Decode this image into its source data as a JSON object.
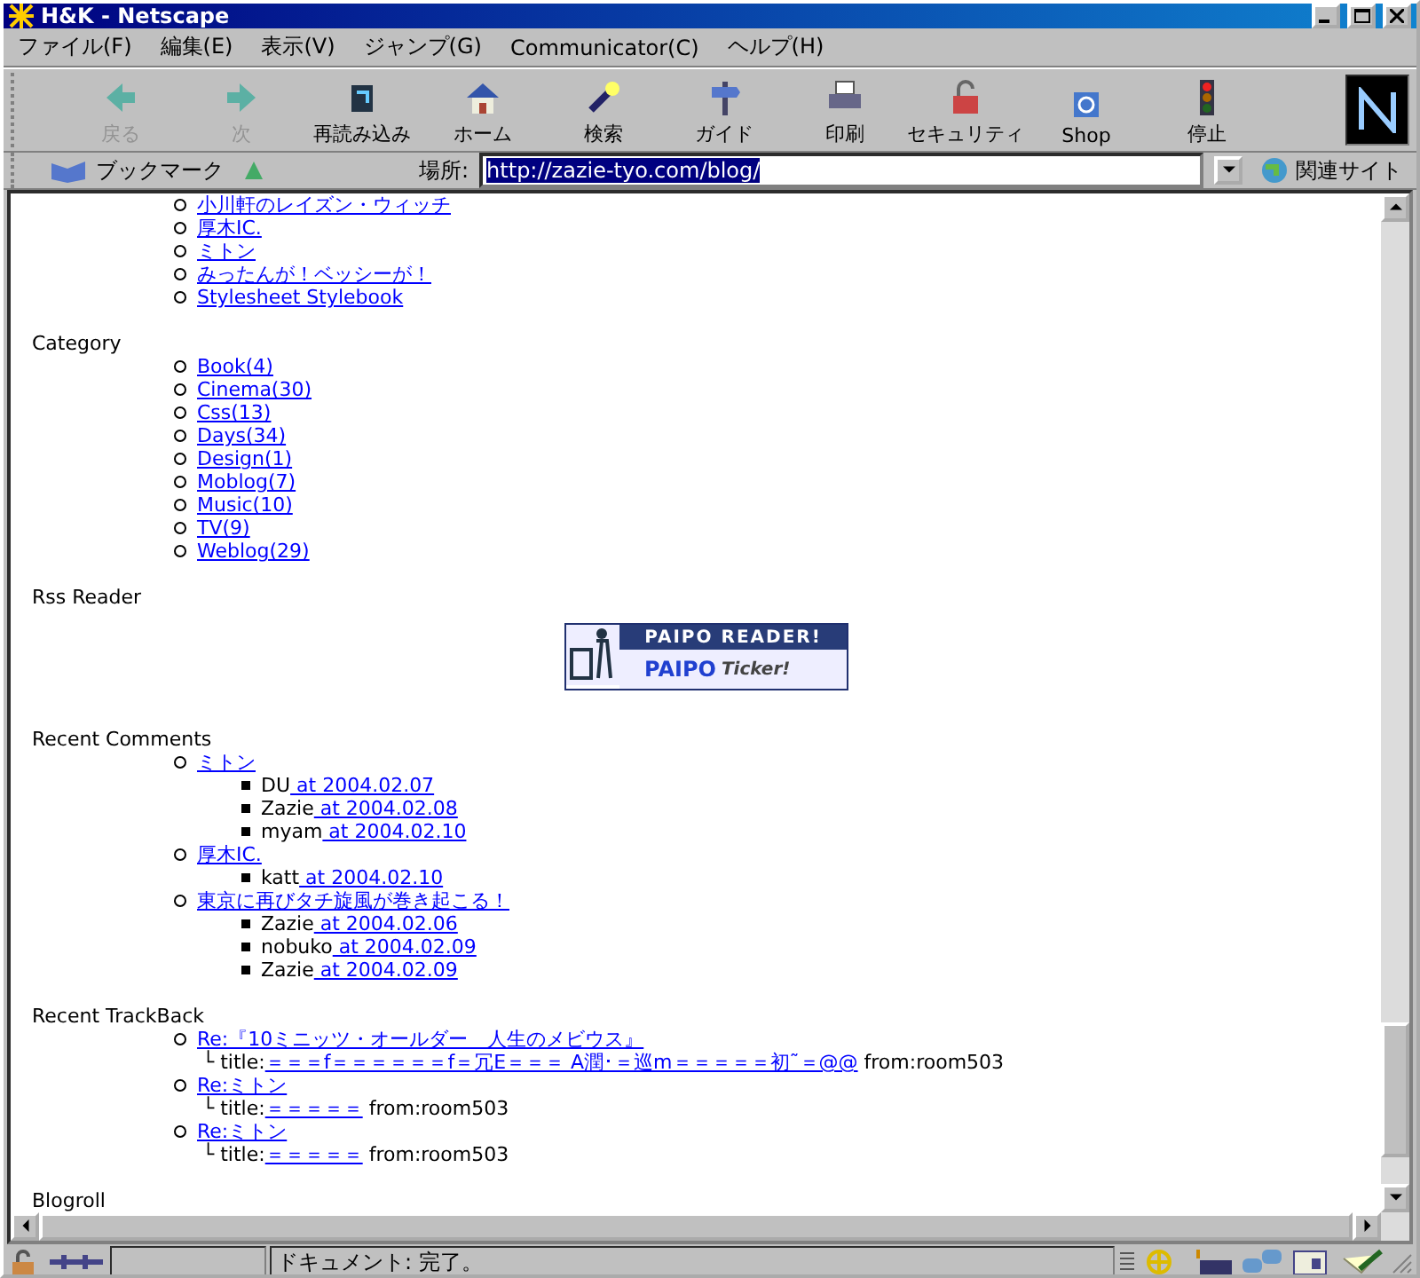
{
  "window": {
    "title": "H&K - Netscape"
  },
  "menu": [
    "ファイル(F)",
    "編集(E)",
    "表示(V)",
    "ジャンプ(G)",
    "Communicator(C)",
    "ヘルプ(H)"
  ],
  "toolbar": [
    {
      "label": "戻る",
      "disabled": true
    },
    {
      "label": "次",
      "disabled": true
    },
    {
      "label": "再読み込み",
      "disabled": false
    },
    {
      "label": "ホーム",
      "disabled": false
    },
    {
      "label": "検索",
      "disabled": false
    },
    {
      "label": "ガイド",
      "disabled": false
    },
    {
      "label": "印刷",
      "disabled": false
    },
    {
      "label": "セキュリティ",
      "disabled": false
    },
    {
      "label": "Shop",
      "disabled": false
    },
    {
      "label": "停止",
      "disabled": false
    }
  ],
  "location": {
    "bookmarks": "ブックマーク",
    "label": "場所:",
    "url": "http://zazie-tyo.com/blog/",
    "related": "関連サイト"
  },
  "content": {
    "top_links": [
      "小川軒のレイズン・ウィッチ",
      "厚木IC.",
      "ミトン",
      "みったんが！ベッシーが！",
      "Stylesheet Stylebook"
    ],
    "category": {
      "heading": "Category",
      "items": [
        "Book(4)",
        "Cinema(30)",
        "Css(13)",
        "Days(34)",
        "Design(1)",
        "Moblog(7)",
        "Music(10)",
        "TV(9)",
        "Weblog(29)"
      ]
    },
    "rss": {
      "heading": "Rss Reader",
      "banner": {
        "title": "PAIPO READER!",
        "brand": "PAIPO",
        "tag": "Ticker!"
      }
    },
    "comments": {
      "heading": "Recent Comments",
      "entries": [
        {
          "title": "ミトン",
          "children": [
            {
              "author": "DU",
              "date": " at 2004.02.07"
            },
            {
              "author": "Zazie",
              "date": " at 2004.02.08"
            },
            {
              "author": "myam",
              "date": " at 2004.02.10"
            }
          ]
        },
        {
          "title": "厚木IC.",
          "children": [
            {
              "author": "katt",
              "date": " at 2004.02.10"
            }
          ]
        },
        {
          "title": "東京に再びタチ旋風が巻き起こる！",
          "children": [
            {
              "author": "Zazie",
              "date": " at 2004.02.06"
            },
            {
              "author": "nobuko",
              "date": " at 2004.02.09"
            },
            {
              "author": "Zazie",
              "date": " at 2004.02.09"
            }
          ]
        }
      ]
    },
    "trackbacks": {
      "heading": "Recent TrackBack",
      "entries": [
        {
          "title": "Re:『10ミニッツ・オールダー　人生のメビウス』",
          "prefix": "└ title:",
          "link": "＝＝＝f＝＝＝＝＝＝f＝冗E＝＝＝ A潤･＝巡m＝＝＝＝＝初˜＝@@",
          "from": " from:room503"
        },
        {
          "title": "Re:ミトン",
          "prefix": "└ title:",
          "link": "＝＝＝＝＝",
          "from": " from:room503"
        },
        {
          "title": "Re:ミトン",
          "prefix": "└ title:",
          "link": "＝＝＝＝＝",
          "from": " from:room503"
        }
      ]
    },
    "blogroll": {
      "heading": "Blogroll"
    }
  },
  "status": {
    "text": "ドキュメント: 完了。"
  }
}
